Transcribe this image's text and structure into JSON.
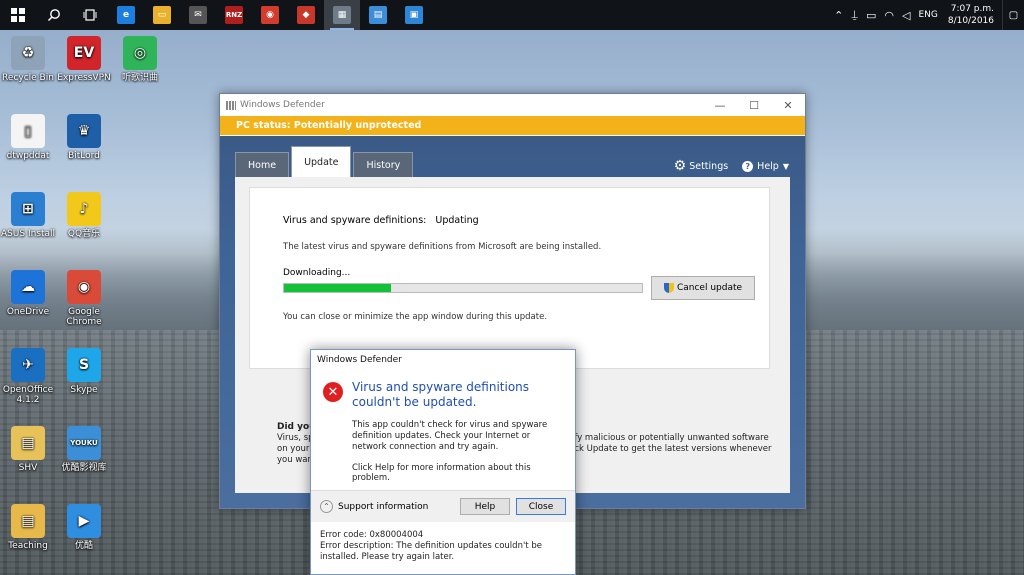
{
  "taskbar": {
    "apps": [
      {
        "icon": "edge-icon",
        "glyph": "e",
        "color": "#1c7fe0"
      },
      {
        "icon": "file-explorer-icon",
        "glyph": "▭",
        "color": "#e9b12c"
      },
      {
        "icon": "mail-icon",
        "glyph": "✉",
        "color": "#555"
      },
      {
        "icon": "rnz-icon",
        "glyph": "RNZ",
        "color": "#b01e1e"
      },
      {
        "icon": "antivirus-icon",
        "glyph": "◉",
        "color": "#d23c2c"
      },
      {
        "icon": "game-icon",
        "glyph": "◆",
        "color": "#c8382a"
      },
      {
        "icon": "windows-defender-icon",
        "glyph": "▦",
        "color": "#6e7c8a"
      },
      {
        "icon": "installer-icon",
        "glyph": "▤",
        "color": "#3d8ed8"
      },
      {
        "icon": "remote-app-icon",
        "glyph": "▣",
        "color": "#2e86d6"
      }
    ],
    "tray": {
      "lang": "ENG",
      "time": "7:07 p.m.",
      "date": "8/10/2016"
    }
  },
  "desktop": {
    "icons": [
      {
        "name": "recycle-bin-icon",
        "label": "Recycle Bin",
        "glyph": "♻",
        "color": "#8fa3b8"
      },
      {
        "name": "expressvpn-icon",
        "label": "ExpressVPN",
        "glyph": "EV",
        "color": "#d1242b"
      },
      {
        "name": "music-app-icon",
        "label": "听歌识曲",
        "glyph": "◎",
        "color": "#2fb45a"
      },
      {
        "name": "text-file-icon",
        "label": "dtwpddat",
        "glyph": "▯",
        "color": "#f4f4f4"
      },
      {
        "name": "bitlord-icon",
        "label": "BitLord",
        "glyph": "♛",
        "color": "#1f5fa8"
      },
      {
        "name": "asus-install-icon",
        "label": "ASUS Install",
        "glyph": "⊞",
        "color": "#2a7fd0"
      },
      {
        "name": "qq-music-icon",
        "label": "QQ音乐",
        "glyph": "♪",
        "color": "#f2c81a"
      },
      {
        "name": "onedrive-icon",
        "label": "OneDrive",
        "glyph": "☁",
        "color": "#1e73d8"
      },
      {
        "name": "chrome-icon",
        "label": "Google Chrome",
        "glyph": "◉",
        "color": "#d94a38"
      },
      {
        "name": "openoffice-icon",
        "label": "OpenOffice 4.1.2",
        "glyph": "✈",
        "color": "#1b6fc1"
      },
      {
        "name": "skype-icon",
        "label": "Skype",
        "glyph": "S",
        "color": "#1ea6e8"
      },
      {
        "name": "shv-folder-icon",
        "label": "SHV",
        "glyph": "▤",
        "color": "#e7c25a"
      },
      {
        "name": "youku-icon",
        "label": "优酷影视库",
        "glyph": "YOUKU",
        "color": "#3c8fd6"
      },
      {
        "name": "teaching-folder-icon",
        "label": "Teaching",
        "glyph": "▤",
        "color": "#e7b94a"
      },
      {
        "name": "youku-player-icon",
        "label": "优酷",
        "glyph": "▶",
        "color": "#2f8ee0"
      }
    ]
  },
  "defender": {
    "title": "Windows Defender",
    "status": "PC status: Potentially unprotected",
    "tabs": [
      "Home",
      "Update",
      "History"
    ],
    "settings_label": "Settings",
    "help_label": "Help",
    "update": {
      "defs_label": "Virus and spyware definitions:",
      "defs_value": "Updating",
      "description": "The latest virus and spyware definitions from Microsoft are being installed.",
      "downloading_label": "Downloading...",
      "progress": 0.3,
      "cancel_label": "Cancel update",
      "note": "You can close or minimize the app window during this update."
    },
    "did_you_know": {
      "heading": "Did you",
      "line1": "Virus, spy",
      "line2": "on your l",
      "line3": "you want",
      "right1": "ify malicious or potentially unwanted software",
      "right2": "ick Update to get the latest versions whenever"
    }
  },
  "error_dialog": {
    "title": "Windows Defender",
    "heading": "Virus and spyware definitions couldn't be updated.",
    "message": "This app couldn't check for virus and spyware definition updates. Check your Internet or network connection and try again.",
    "help_hint": "Click Help for more information about this problem.",
    "support_label": "Support information",
    "help_button": "Help",
    "close_button": "Close",
    "error_code": "Error code: 0x80004004",
    "error_description": "Error description: The definition updates couldn't be installed. Please try again later."
  }
}
